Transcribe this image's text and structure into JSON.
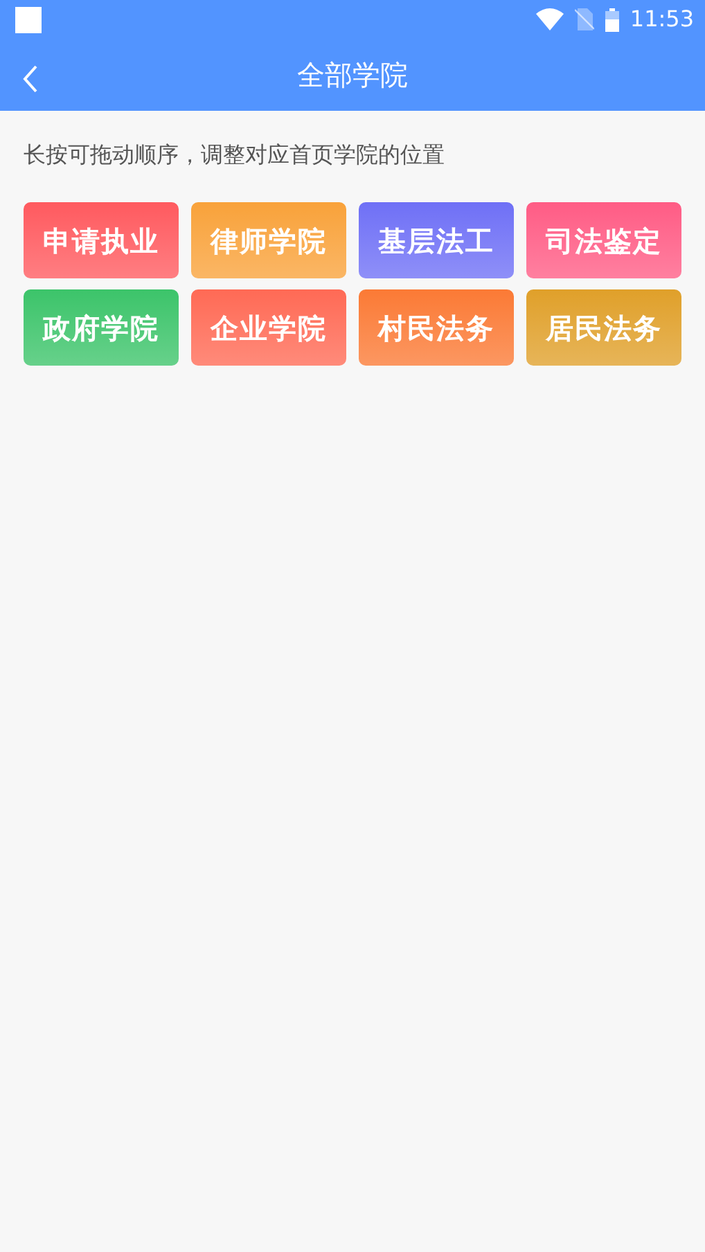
{
  "status_bar": {
    "time": "11:53"
  },
  "nav": {
    "title": "全部学院"
  },
  "hint": "长按可拖动顺序，调整对应首页学院的位置",
  "tiles": [
    {
      "label": "申请执业",
      "color": "#ff5a5f"
    },
    {
      "label": "律师学院",
      "color": "#f9a23a"
    },
    {
      "label": "基层法工",
      "color": "#6f70f6"
    },
    {
      "label": "司法鉴定",
      "color": "#ff5c85"
    },
    {
      "label": "政府学院",
      "color": "#3cc46a"
    },
    {
      "label": "企业学院",
      "color": "#ff6a55"
    },
    {
      "label": "村民法务",
      "color": "#fb7a35"
    },
    {
      "label": "居民法务",
      "color": "#e0a02a"
    }
  ]
}
